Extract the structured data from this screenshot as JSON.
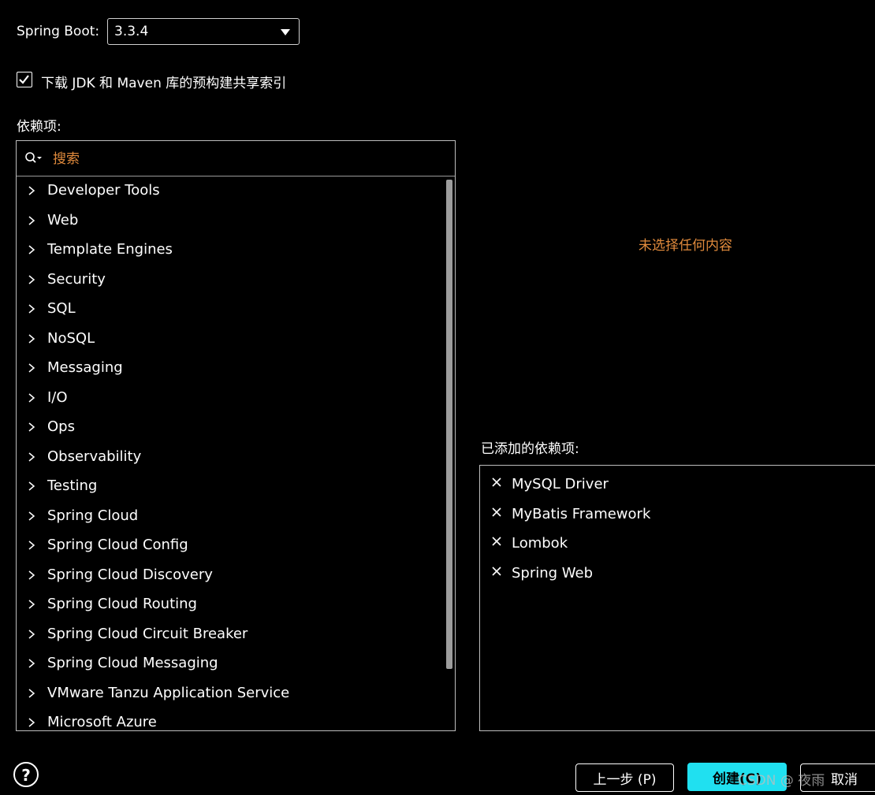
{
  "spring_boot": {
    "label": "Spring Boot:",
    "version": "3.3.4"
  },
  "shared_index": {
    "checked": true,
    "label": "下载 JDK 和 Maven 库的预构建共享索引"
  },
  "dependencies": {
    "label": "依赖项:",
    "search_placeholder": "搜索",
    "categories": [
      "Developer Tools",
      "Web",
      "Template Engines",
      "Security",
      "SQL",
      "NoSQL",
      "Messaging",
      "I/O",
      "Ops",
      "Observability",
      "Testing",
      "Spring Cloud",
      "Spring Cloud Config",
      "Spring Cloud Discovery",
      "Spring Cloud Routing",
      "Spring Cloud Circuit Breaker",
      "Spring Cloud Messaging",
      "VMware Tanzu Application Service",
      "Microsoft Azure"
    ],
    "empty_selection_text": "未选择任何内容"
  },
  "added": {
    "label": "已添加的依赖项:",
    "items": [
      "MySQL Driver",
      "MyBatis Framework",
      "Lombok",
      "Spring Web"
    ]
  },
  "buttons": {
    "help": "?",
    "prev": "上一步 (P)",
    "create": "创建(C)",
    "cancel": "取消"
  },
  "watermark": "CSDN @ 夜雨",
  "colors": {
    "accent_orange": "#e08a3c",
    "primary_button": "#20e0f0"
  }
}
